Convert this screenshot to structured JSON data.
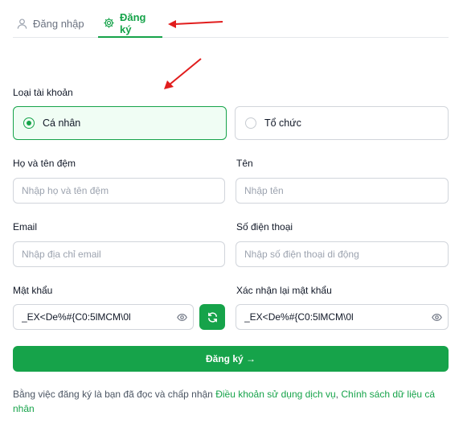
{
  "tabs": {
    "login": "Đăng nhập",
    "register": "Đăng ký"
  },
  "account_type": {
    "label": "Loại tài khoản",
    "personal": "Cá nhân",
    "organization": "Tổ chức",
    "selected": "personal"
  },
  "fields": {
    "last_name": {
      "label": "Họ và tên đệm",
      "placeholder": "Nhập họ và tên đệm",
      "value": ""
    },
    "first_name": {
      "label": "Tên",
      "placeholder": "Nhập tên",
      "value": ""
    },
    "email": {
      "label": "Email",
      "placeholder": "Nhập địa chỉ email",
      "value": ""
    },
    "phone": {
      "label": "Số điện thoại",
      "placeholder": "Nhập số điện thoại di động",
      "value": ""
    },
    "password": {
      "label": "Mật khẩu",
      "value": "_EX<De%#{C0:5lMCM\\0l"
    },
    "confirm_password": {
      "label": "Xác nhận lại mật khẩu",
      "value": "_EX<De%#{C0:5lMCM\\0l"
    }
  },
  "submit_label": "Đăng ký →",
  "terms": {
    "prefix": "Bằng việc đăng ký là bạn đã đọc và chấp nhận ",
    "terms_link": "Điều khoản sử dụng dịch vụ",
    "separator": ", ",
    "privacy_link": "Chính sách dữ liệu cá nhân"
  },
  "colors": {
    "accent": "#16a34a",
    "annotation_arrow": "#e11d1d"
  },
  "icons": {
    "login": "user-icon",
    "register": "gear-icon",
    "password_toggle": "eye-icon",
    "regenerate": "refresh-icon"
  }
}
